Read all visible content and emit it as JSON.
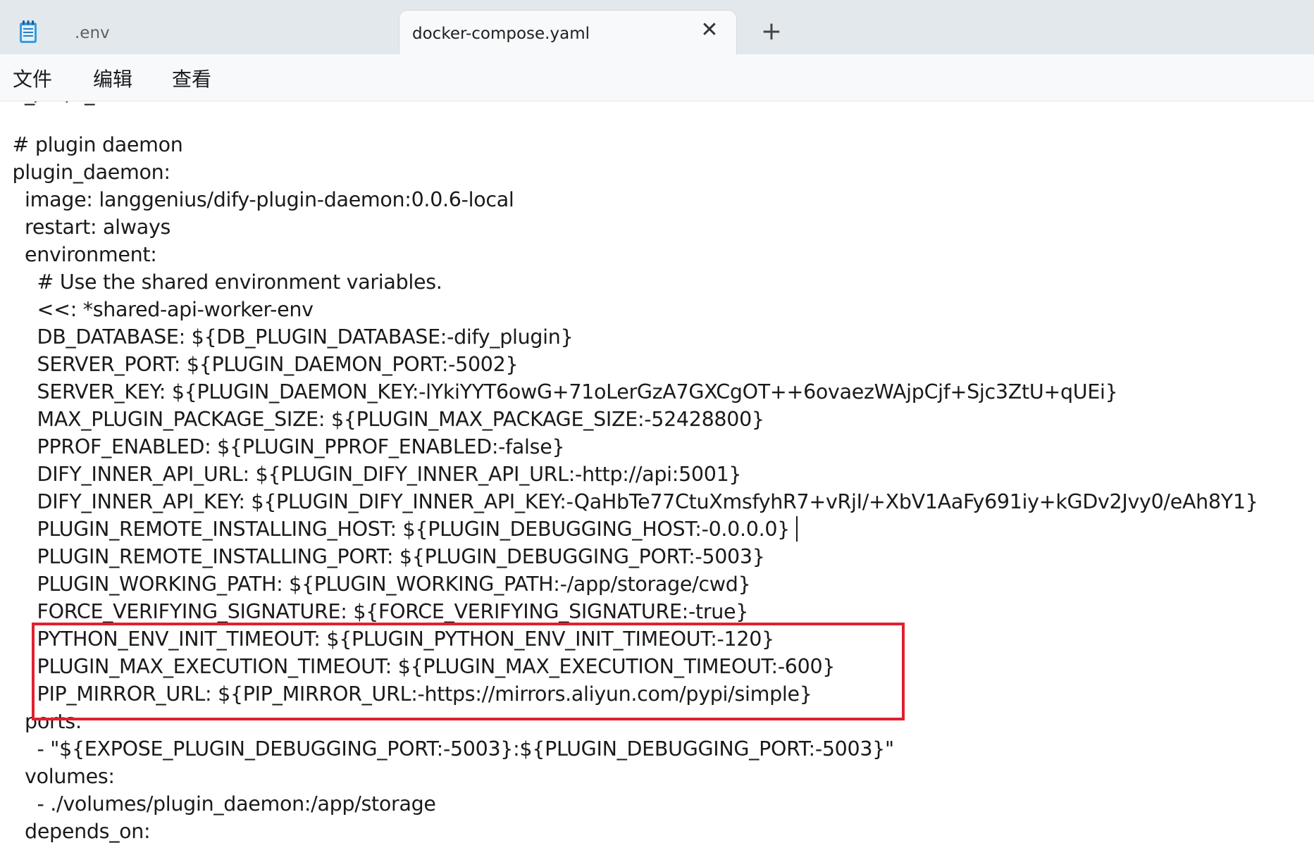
{
  "tabs": [
    {
      "label": ".env",
      "active": false
    },
    {
      "label": "docker-compose.yaml",
      "active": true
    }
  ],
  "tab_close_glyph": "✕",
  "new_tab_glyph": "+",
  "menu": [
    "文件",
    "编辑",
    "查看"
  ],
  "editor": {
    "lines": [
      "    _/    /  _",
      "",
      "  # plugin daemon",
      "  plugin_daemon:",
      "    image: langgenius/dify-plugin-daemon:0.0.6-local",
      "    restart: always",
      "    environment:",
      "      # Use the shared environment variables.",
      "      <<: *shared-api-worker-env",
      "      DB_DATABASE: ${DB_PLUGIN_DATABASE:-dify_plugin}",
      "      SERVER_PORT: ${PLUGIN_DAEMON_PORT:-5002}",
      "      SERVER_KEY: ${PLUGIN_DAEMON_KEY:-lYkiYYT6owG+71oLerGzA7GXCgOT++6ovaezWAjpCjf+Sjc3ZtU+qUEi}",
      "      MAX_PLUGIN_PACKAGE_SIZE: ${PLUGIN_MAX_PACKAGE_SIZE:-52428800}",
      "      PPROF_ENABLED: ${PLUGIN_PPROF_ENABLED:-false}",
      "      DIFY_INNER_API_URL: ${PLUGIN_DIFY_INNER_API_URL:-http://api:5001}",
      "      DIFY_INNER_API_KEY: ${PLUGIN_DIFY_INNER_API_KEY:-QaHbTe77CtuXmsfyhR7+vRjI/+XbV1AaFy691iy+kGDv2Jvy0/eAh8Y1}",
      "      PLUGIN_REMOTE_INSTALLING_HOST: ${PLUGIN_DEBUGGING_HOST:-0.0.0.0}",
      "      PLUGIN_REMOTE_INSTALLING_PORT: ${PLUGIN_DEBUGGING_PORT:-5003}",
      "      PLUGIN_WORKING_PATH: ${PLUGIN_WORKING_PATH:-/app/storage/cwd}",
      "      FORCE_VERIFYING_SIGNATURE: ${FORCE_VERIFYING_SIGNATURE:-true}",
      "      PYTHON_ENV_INIT_TIMEOUT: ${PLUGIN_PYTHON_ENV_INIT_TIMEOUT:-120}",
      "      PLUGIN_MAX_EXECUTION_TIMEOUT: ${PLUGIN_MAX_EXECUTION_TIMEOUT:-600}",
      "      PIP_MIRROR_URL: ${PIP_MIRROR_URL:-https://mirrors.aliyun.com/pypi/simple}",
      "    ports:",
      "      - \"${EXPOSE_PLUGIN_DEBUGGING_PORT:-5003}:${PLUGIN_DEBUGGING_PORT:-5003}\"",
      "    volumes:",
      "      - ./volumes/plugin_daemon:/app/storage",
      "    depends_on:"
    ]
  },
  "colors": {
    "highlight_border": "#e0202e",
    "tabstrip_bg": "#e3e8ec",
    "menubar_bg": "#f7f9fa",
    "text": "#1a1a1a"
  }
}
